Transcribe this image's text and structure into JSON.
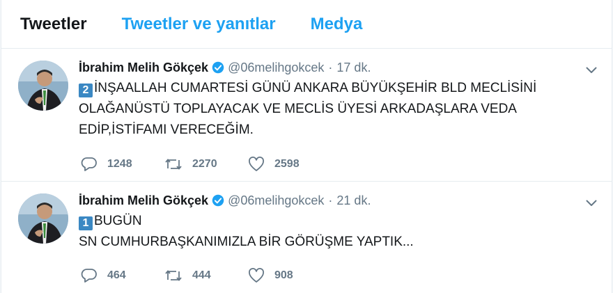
{
  "tabs": [
    {
      "label": "Tweetler",
      "active": true
    },
    {
      "label": "Tweetler ve yanıtlar",
      "active": false
    },
    {
      "label": "Medya",
      "active": false
    }
  ],
  "colors": {
    "accent": "#1da1f2",
    "text": "#14171a",
    "muted": "#657786",
    "emoji_box": "#3b88c3"
  },
  "tweets": [
    {
      "name": "İbrahim Melih Gökçek",
      "handle": "@06melihgokcek",
      "separator": "·",
      "time": "17 dk.",
      "number_emoji": "2",
      "lines": [
        "İNŞAALLAH CUMARTESİ GÜNÜ ANKARA BÜYÜKŞEHİR BLD MECLİSİNİ",
        "OLAĞANÜSTÜ TOPLAYACAK VE MECLİS ÜYESİ ARKADAŞLARA VEDA",
        "EDİP,İSTİFAMI VERECEĞİM."
      ],
      "replies": "1248",
      "retweets": "2270",
      "likes": "2598"
    },
    {
      "name": "İbrahim Melih Gökçek",
      "handle": "@06melihgokcek",
      "separator": "·",
      "time": "21 dk.",
      "number_emoji": "1",
      "lines": [
        "BUGÜN",
        "SN CUMHURBAŞKANIMIZLA BİR GÖRÜŞME YAPTIK..."
      ],
      "replies": "464",
      "retweets": "444",
      "likes": "908"
    }
  ]
}
